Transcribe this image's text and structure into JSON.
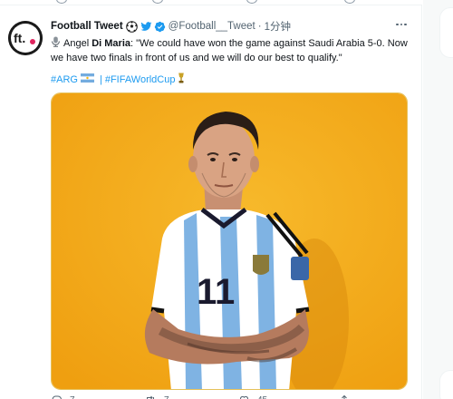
{
  "tweet": {
    "author_name": "Football Tweet",
    "handle": "@Football__Tweet",
    "separator": "·",
    "time": "1分钟",
    "avatar_text": "ft.",
    "text": {
      "prefix": "Angel ",
      "bold_name": "Di Maria",
      "quote": ": \"We could have won the game against Saudi Arabia 5-0. Now we have two finals in front of us and we will do our best to qualify.\""
    },
    "hashtags": [
      "#ARG",
      "#FIFAWorldCup"
    ],
    "hashtag_separator": "|"
  },
  "actions": {
    "reply_count": "7",
    "retweet_count": "7",
    "like_count": "45"
  },
  "colors": {
    "accent": "#1d9bf0",
    "media_background": "#f2ad1a",
    "text_primary": "#0f1419",
    "text_secondary": "#536471"
  },
  "icons": {
    "header": [
      "soccer-ball-icon",
      "twitter-bird-icon",
      "verified-badge-icon"
    ],
    "text": [
      "microphone-icon"
    ],
    "tags": [
      "argentina-flag-icon",
      "trophy-icon"
    ],
    "actions": [
      "reply-icon",
      "retweet-icon",
      "like-icon",
      "share-icon"
    ]
  }
}
